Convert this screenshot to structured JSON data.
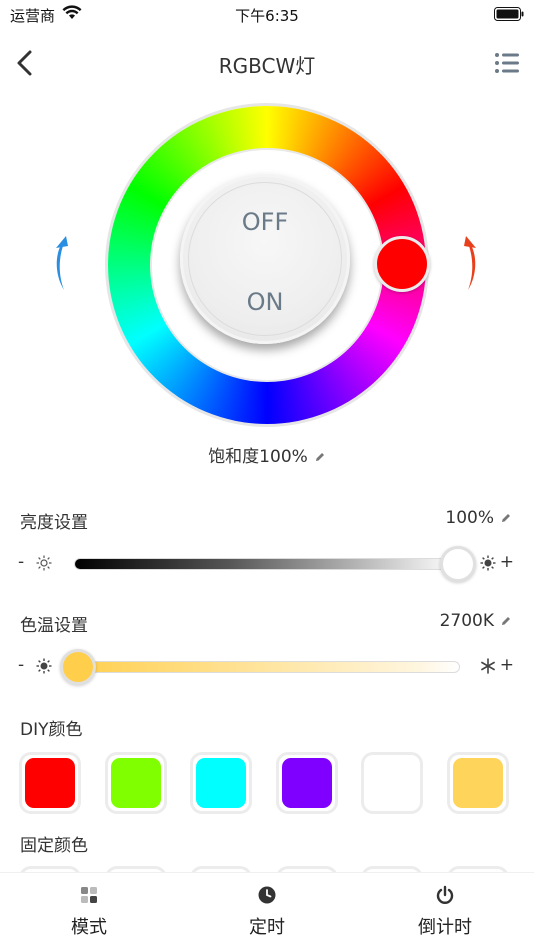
{
  "status_bar": {
    "carrier": "运营商",
    "time": "下午6:35"
  },
  "nav": {
    "title": "RGBCW灯"
  },
  "wheel": {
    "off_label": "OFF",
    "on_label": "ON",
    "selected_color": "#ff0000"
  },
  "saturation": {
    "text": "饱和度100%"
  },
  "brightness": {
    "label": "亮度设置",
    "value_text": "100%",
    "value": 1.0,
    "minus": "-",
    "plus": "+"
  },
  "color_temp": {
    "label": "色温设置",
    "value_text": "2700K",
    "value": 0.0,
    "minus": "-",
    "plus": "+"
  },
  "diy_colors": {
    "label": "DIY颜色",
    "swatches": [
      "#ff0000",
      "#80ff00",
      "#00ffff",
      "#8000ff",
      "#ffffff",
      "#ffd45a"
    ]
  },
  "fixed_colors": {
    "label": "固定颜色",
    "swatches": [
      "#ff0000",
      "#80ff00",
      "#00ffff",
      "#8000ff",
      "#ffffff",
      "#ffd45a"
    ]
  },
  "tab_bar": {
    "tabs": [
      {
        "label": "模式",
        "icon": "grid-icon"
      },
      {
        "label": "定时",
        "icon": "clock-icon"
      },
      {
        "label": "倒计时",
        "icon": "power-icon"
      }
    ]
  }
}
